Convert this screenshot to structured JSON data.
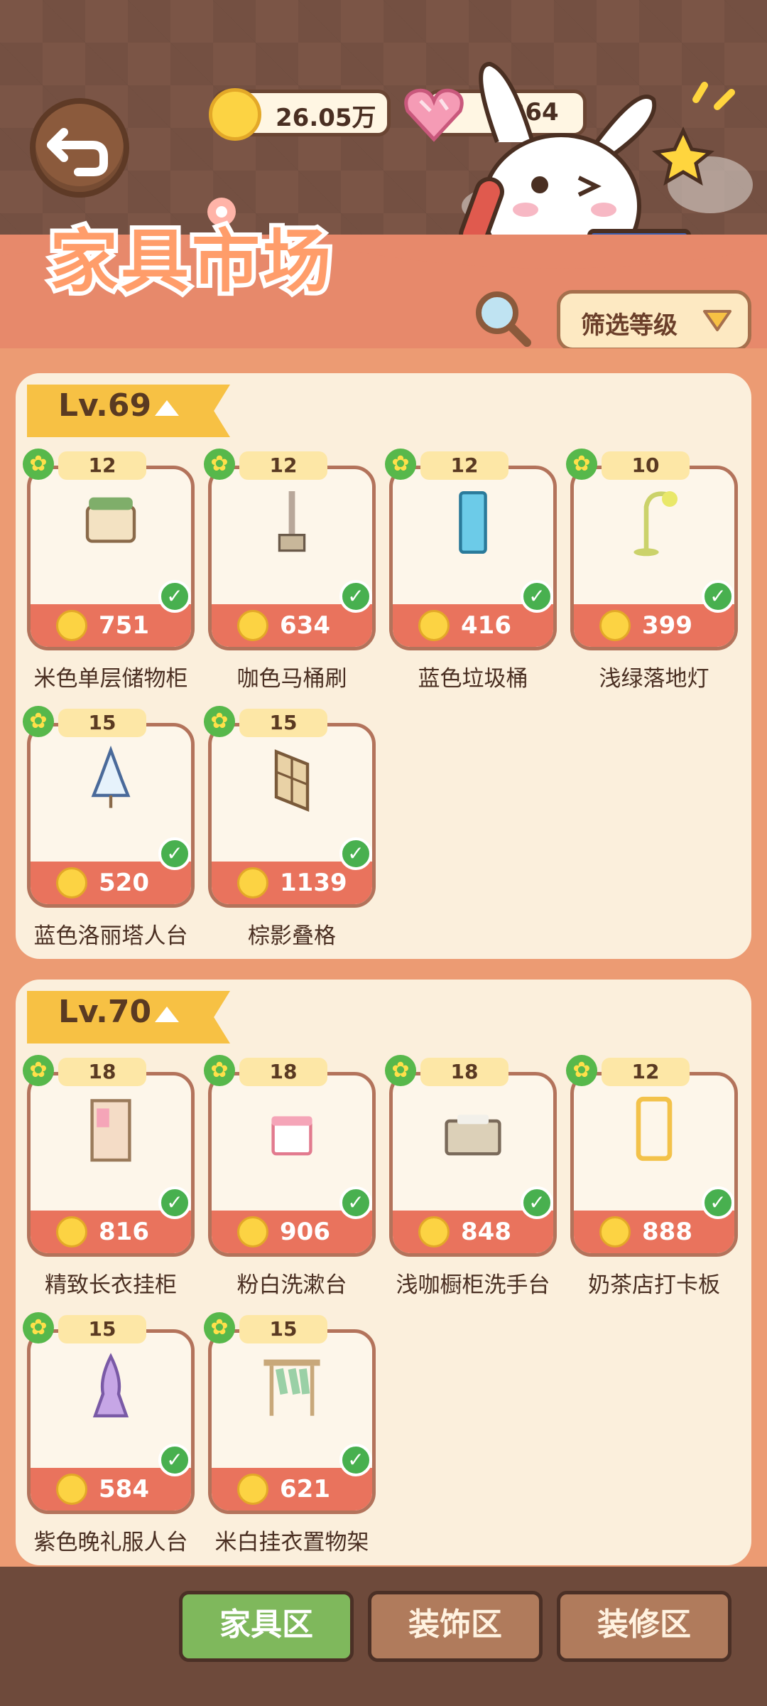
{
  "header": {
    "coins": "26.05万",
    "gems": "7264",
    "title": "家具市场",
    "filter_label": "筛选等级"
  },
  "sections": [
    {
      "level": "Lv.69",
      "items": [
        {
          "name": "米色单层储物柜",
          "level": "12",
          "price": "751"
        },
        {
          "name": "咖色马桶刷",
          "level": "12",
          "price": "634"
        },
        {
          "name": "蓝色垃圾桶",
          "level": "12",
          "price": "416"
        },
        {
          "name": "浅绿落地灯",
          "level": "10",
          "price": "399"
        },
        {
          "name": "蓝色洛丽塔人台",
          "level": "15",
          "price": "520"
        },
        {
          "name": "棕影叠格",
          "level": "15",
          "price": "1139"
        }
      ]
    },
    {
      "level": "Lv.70",
      "items": [
        {
          "name": "精致长衣挂柜",
          "level": "18",
          "price": "816"
        },
        {
          "name": "粉白洗漱台",
          "level": "18",
          "price": "906"
        },
        {
          "name": "浅咖橱柜洗手台",
          "level": "18",
          "price": "848"
        },
        {
          "name": "奶茶店打卡板",
          "level": "12",
          "price": "888"
        },
        {
          "name": "紫色晚礼服人台",
          "level": "15",
          "price": "584"
        },
        {
          "name": "米白挂衣置物架",
          "level": "15",
          "price": "621"
        }
      ]
    }
  ],
  "tabs": [
    {
      "label": "家具区",
      "active": true
    },
    {
      "label": "装饰区",
      "active": false
    },
    {
      "label": "装修区",
      "active": false
    }
  ],
  "colors": {
    "accent": "#e9735d",
    "active_tab": "#7fb85c",
    "tab": "#b07b5c"
  }
}
